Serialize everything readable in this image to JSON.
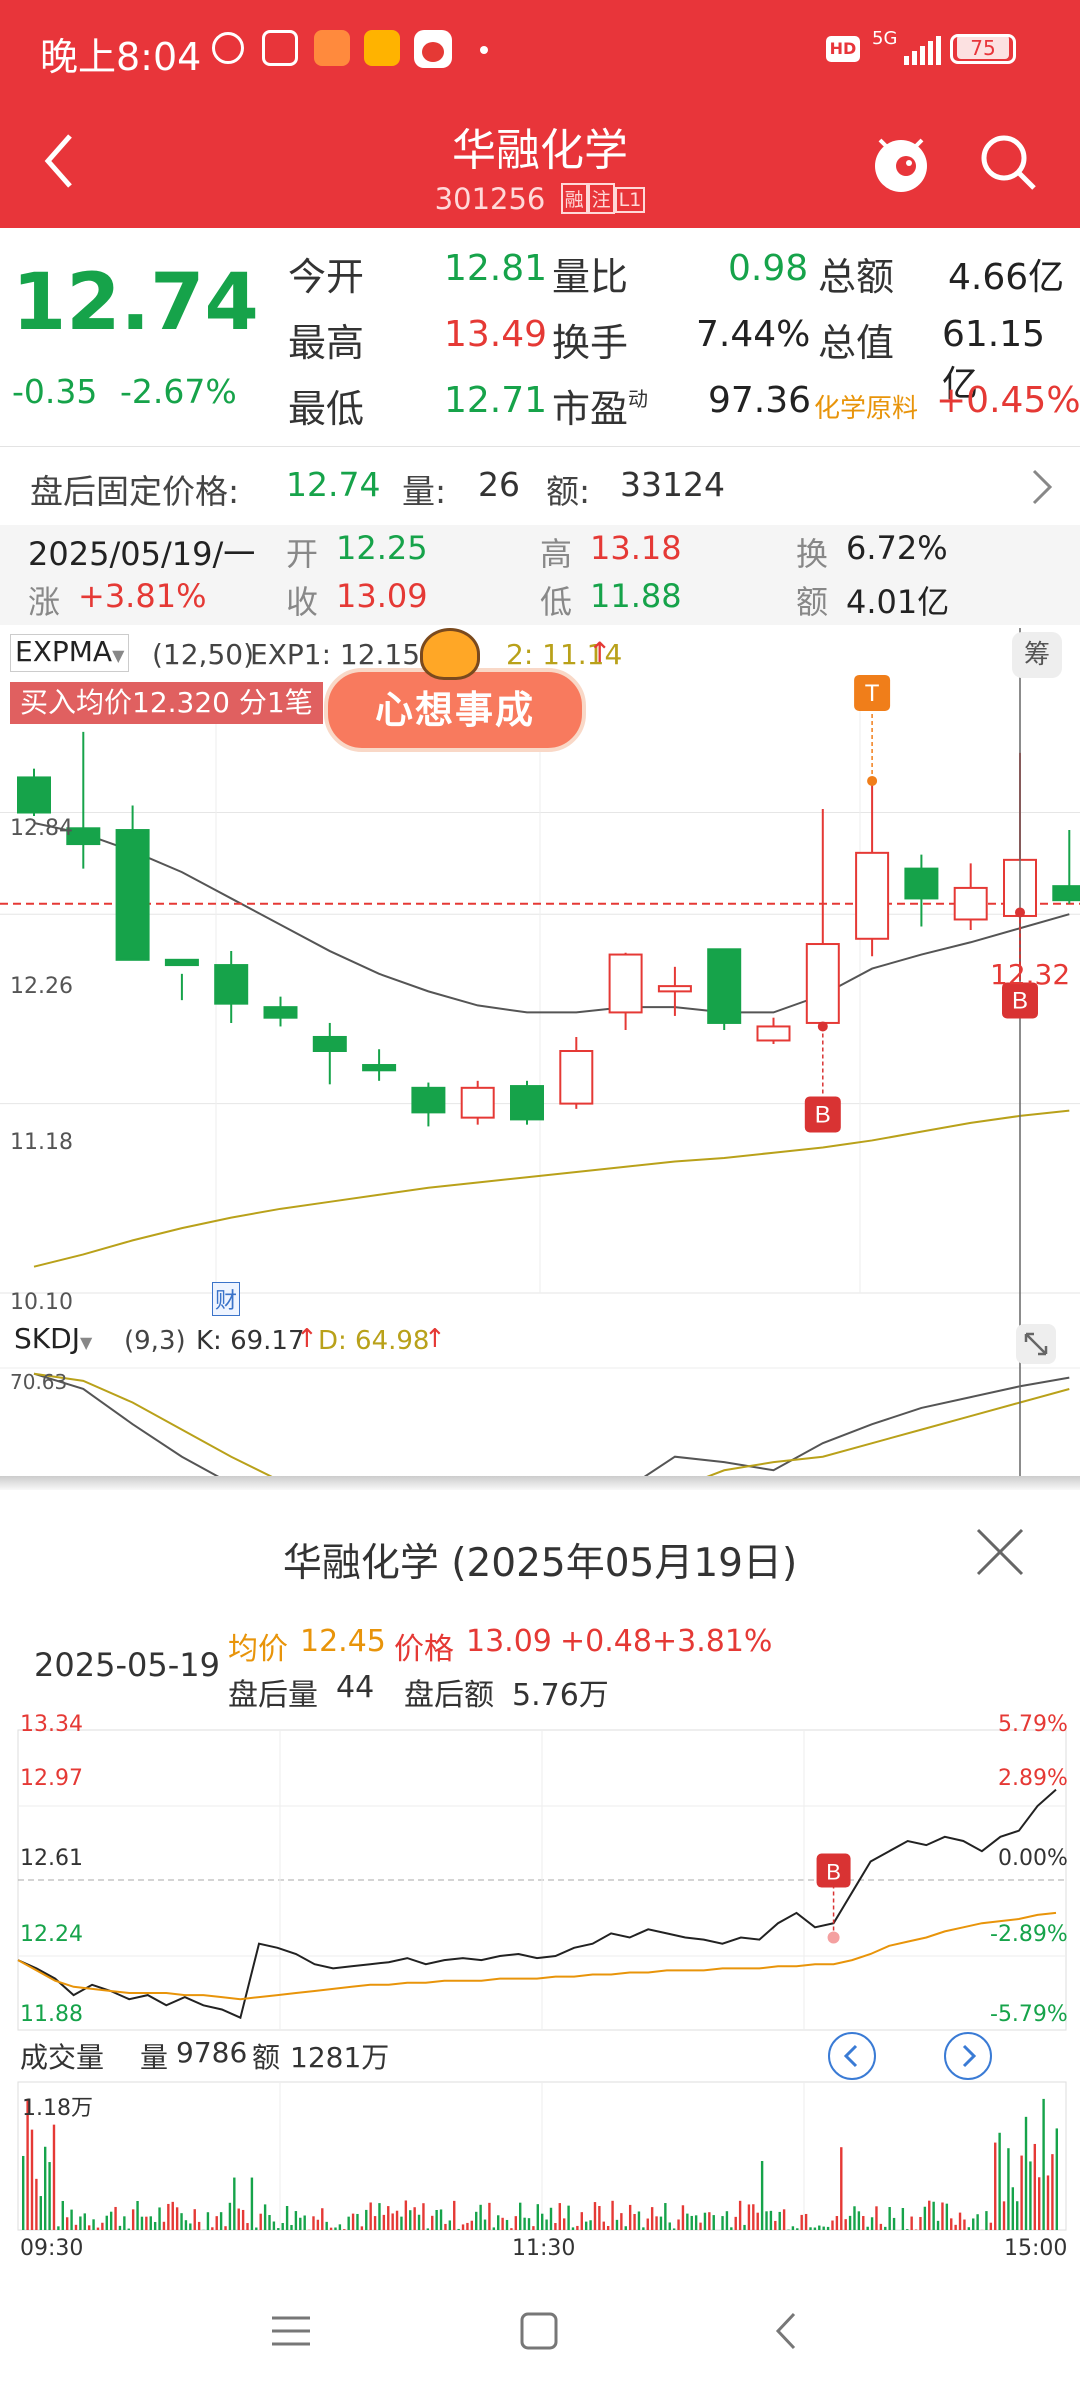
{
  "status_bar": {
    "time": "晚上8:04",
    "network": "5G",
    "battery": "75"
  },
  "header": {
    "title": "华融化学",
    "code": "301256",
    "badge_rong": "融",
    "badge_zhu": "注",
    "badge_l1": "L1"
  },
  "quote": {
    "price": "12.74",
    "change": "-0.35",
    "change_pct": "-2.67%",
    "rows": [
      [
        {
          "label": "今开",
          "value": "12.81",
          "color": "green"
        },
        {
          "label": "量比",
          "value": "0.98",
          "color": "green"
        },
        {
          "label": "总额",
          "value": "4.66亿",
          "color": "dark"
        }
      ],
      [
        {
          "label": "最高",
          "value": "13.49",
          "color": "red"
        },
        {
          "label": "换手",
          "value": "7.44%",
          "color": "dark"
        },
        {
          "label": "总值",
          "value": "61.15亿",
          "color": "dark"
        }
      ],
      [
        {
          "label": "最低",
          "value": "12.71",
          "color": "green"
        },
        {
          "label": "市盈",
          "value": "97.36",
          "color": "dark"
        },
        {
          "label": "化学原料",
          "value": "+0.45%",
          "color": "red"
        }
      ]
    ],
    "pe_sup": "动"
  },
  "after_hours": {
    "label": "盘后固定价格:",
    "price": "12.74",
    "vol_label": "量:",
    "vol": "26",
    "amt_label": "额:",
    "amt": "33124"
  },
  "day_info": {
    "date": "2025/05/19/一",
    "open_label": "开",
    "open": "12.25",
    "high_label": "高",
    "high": "13.18",
    "turn_label": "换",
    "turn": "6.72%",
    "rise_label": "涨",
    "rise": "+3.81%",
    "close_label": "收",
    "close": "13.09",
    "low_label": "低",
    "low": "11.88",
    "amt_label": "额",
    "amt": "4.01亿"
  },
  "main_chart": {
    "indicator": "EXPMA",
    "params": "(12,50)",
    "exp1": "EXP1: 12.15",
    "exp2": "2: 11.14",
    "chip_btn": "筹",
    "buy_banner": "买入均价12.320 分1笔",
    "sticker": "心想事成",
    "y_labels": [
      "12.84",
      "12.26",
      "11.18",
      "10.10"
    ],
    "price_line_label": "12.32",
    "marker_t": "T",
    "marker_b": "B",
    "cai": "财"
  },
  "chart_data": [
    {
      "type": "candlestick",
      "title": "EXPMA (12,50)",
      "y_ticks": [
        12.84,
        12.26,
        11.18,
        10.1
      ],
      "candles": [
        {
          "o": 13.04,
          "c": 12.84,
          "h": 13.09,
          "l": 12.82
        },
        {
          "o": 12.75,
          "c": 12.66,
          "h": 13.3,
          "l": 12.52
        },
        {
          "o": 12.74,
          "c": 12.0,
          "h": 12.88,
          "l": 12.0
        },
        {
          "o": 12.0,
          "c": 11.97,
          "h": 11.92,
          "l": 11.77
        },
        {
          "o": 11.97,
          "c": 11.75,
          "h": 12.05,
          "l": 11.64
        },
        {
          "o": 11.73,
          "c": 11.67,
          "h": 11.79,
          "l": 11.62
        },
        {
          "o": 11.56,
          "c": 11.48,
          "h": 11.64,
          "l": 11.29
        },
        {
          "o": 11.4,
          "c": 11.37,
          "h": 11.49,
          "l": 11.31
        },
        {
          "o": 11.27,
          "c": 11.13,
          "h": 11.3,
          "l": 11.05
        },
        {
          "o": 11.1,
          "c": 11.27,
          "h": 11.31,
          "l": 11.06
        },
        {
          "o": 11.28,
          "c": 11.09,
          "h": 11.31,
          "l": 11.06
        },
        {
          "o": 11.18,
          "c": 11.48,
          "h": 11.56,
          "l": 11.15
        },
        {
          "o": 11.7,
          "c": 12.03,
          "h": 12.04,
          "l": 11.6
        },
        {
          "o": 11.82,
          "c": 11.85,
          "h": 11.96,
          "l": 11.68
        },
        {
          "o": 12.06,
          "c": 11.64,
          "h": 12.06,
          "l": 11.6
        },
        {
          "o": 11.54,
          "c": 11.62,
          "h": 11.67,
          "l": 11.52
        },
        {
          "o": 11.64,
          "c": 12.09,
          "h": 12.86,
          "l": 11.62
        },
        {
          "o": 12.12,
          "c": 12.61,
          "h": 13.04,
          "l": 12.02
        },
        {
          "o": 12.52,
          "c": 12.35,
          "h": 12.6,
          "l": 12.19
        },
        {
          "o": 12.23,
          "c": 12.41,
          "h": 12.55,
          "l": 12.17
        },
        {
          "o": 12.25,
          "c": 12.57,
          "h": 13.18,
          "l": 11.88
        },
        {
          "o": 12.42,
          "c": 12.34,
          "h": 12.74,
          "l": 12.32
        }
      ],
      "exp1": [
        12.78,
        12.72,
        12.62,
        12.5,
        12.35,
        12.2,
        12.05,
        11.92,
        11.82,
        11.74,
        11.7,
        11.7,
        11.73,
        11.73,
        11.7,
        11.7,
        11.8,
        11.95,
        12.03,
        12.1,
        12.18,
        12.26
      ],
      "exp2": [
        10.25,
        10.32,
        10.4,
        10.47,
        10.53,
        10.58,
        10.62,
        10.66,
        10.7,
        10.73,
        10.76,
        10.79,
        10.82,
        10.85,
        10.87,
        10.9,
        10.93,
        10.97,
        11.02,
        11.07,
        11.11,
        11.14
      ]
    },
    {
      "type": "line",
      "title": "SKDJ (9,3)",
      "y_ticks": [
        70.63
      ],
      "series": [
        {
          "name": "K",
          "values": [
            70.63,
            65,
            52,
            40,
            30,
            22,
            18,
            15,
            14,
            16,
            15,
            18,
            28,
            40,
            38,
            35,
            45,
            52,
            58,
            62,
            66,
            69.17
          ]
        },
        {
          "name": "D",
          "values": [
            70.63,
            68,
            60,
            50,
            40,
            31,
            25,
            20,
            17,
            16,
            15,
            16,
            20,
            28,
            35,
            38,
            40,
            45,
            50,
            55,
            60,
            64.98
          ]
        }
      ]
    },
    {
      "type": "line",
      "title": "华融化学 (2025年05月19日) 分时",
      "y_ticks": [
        13.34,
        12.97,
        12.61,
        12.24,
        11.88
      ],
      "y_pct_ticks": [
        "5.79%",
        "2.89%",
        "0.00%",
        "-2.89%",
        "-5.79%"
      ],
      "x_ticks": [
        "09:30",
        "11:30",
        "15:00"
      ],
      "series": [
        {
          "name": "价格",
          "values": [
            12.22,
            12.18,
            12.13,
            12.05,
            12.1,
            12.07,
            12.03,
            12.05,
            12.0,
            12.04,
            12.0,
            11.98,
            11.94,
            12.3,
            12.28,
            12.25,
            12.2,
            12.18,
            12.19,
            12.2,
            12.21,
            12.23,
            12.2,
            12.22,
            12.23,
            12.22,
            12.24,
            12.25,
            12.23,
            12.24,
            12.28,
            12.3,
            12.35,
            12.33,
            12.37,
            12.35,
            12.33,
            12.32,
            12.3,
            12.33,
            12.32,
            12.4,
            12.45,
            12.38,
            12.4,
            12.55,
            12.7,
            12.75,
            12.8,
            12.78,
            12.82,
            12.8,
            12.75,
            12.82,
            12.85,
            12.97,
            13.05
          ]
        },
        {
          "name": "均价",
          "values": [
            12.22,
            12.17,
            12.12,
            12.09,
            12.08,
            12.07,
            12.06,
            12.06,
            12.06,
            12.05,
            12.05,
            12.04,
            12.03,
            12.04,
            12.05,
            12.06,
            12.07,
            12.08,
            12.09,
            12.1,
            12.1,
            12.11,
            12.11,
            12.12,
            12.12,
            12.12,
            12.13,
            12.13,
            12.13,
            12.14,
            12.14,
            12.15,
            12.15,
            12.16,
            12.16,
            12.17,
            12.17,
            12.17,
            12.18,
            12.18,
            12.18,
            12.19,
            12.19,
            12.2,
            12.2,
            12.22,
            12.25,
            12.29,
            12.31,
            12.33,
            12.36,
            12.38,
            12.4,
            12.41,
            12.42,
            12.44,
            12.45
          ]
        }
      ]
    }
  ],
  "skdj": {
    "indicator": "SKDJ",
    "params": "(9,3)",
    "k": "K: 69.17",
    "d": "D: 64.98",
    "top_label": "70.63"
  },
  "popup": {
    "title": "华融化学 (2025年05月19日)",
    "date": "2025-05-19",
    "avg_label": "均价",
    "avg": "12.45",
    "price_label": "价格",
    "price": "13.09",
    "chg": "+0.48",
    "chg_pct": "+3.81%",
    "ah_vol_label": "盘后量",
    "ah_vol": "44",
    "ah_amt_label": "盘后额",
    "ah_amt": "5.76万",
    "y_left": [
      "13.34",
      "12.97",
      "12.61",
      "12.24",
      "11.88"
    ],
    "y_right": [
      "5.79%",
      "2.89%",
      "0.00%",
      "-2.89%",
      "-5.79%"
    ],
    "marker_b": "B",
    "vol_title": "成交量",
    "vol_label": "量",
    "vol": "9786",
    "amt_label": "额",
    "amt": "1281万",
    "vol_max": "1.18万",
    "x_labels": [
      "09:30",
      "11:30",
      "15:00"
    ]
  },
  "colors": {
    "brand_red": "#e8353a",
    "up": "#e53935",
    "down": "#16a34a",
    "gold": "#e8940a",
    "expma2": "#b9a11a"
  }
}
